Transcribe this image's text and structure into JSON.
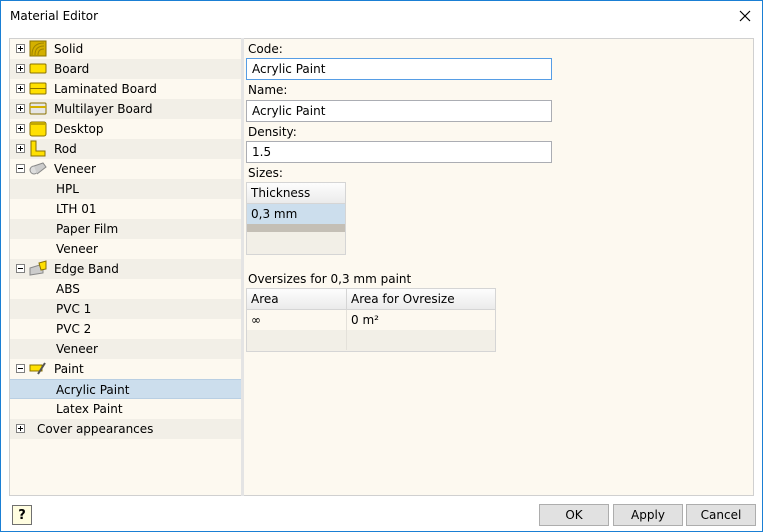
{
  "window": {
    "title": "Material Editor"
  },
  "tree": {
    "items": [
      {
        "label": "Solid",
        "level": 0,
        "expander": "plus",
        "icon": "solid-wood-icon"
      },
      {
        "label": "Board",
        "level": 0,
        "expander": "plus",
        "icon": "board-icon"
      },
      {
        "label": "Laminated Board",
        "level": 0,
        "expander": "plus",
        "icon": "laminated-board-icon"
      },
      {
        "label": "Multilayer Board",
        "level": 0,
        "expander": "plus",
        "icon": "multilayer-board-icon"
      },
      {
        "label": "Desktop",
        "level": 0,
        "expander": "plus",
        "icon": "desktop-icon"
      },
      {
        "label": "Rod",
        "level": 0,
        "expander": "plus",
        "icon": "rod-icon"
      },
      {
        "label": "Veneer",
        "level": 0,
        "expander": "minus",
        "icon": "veneer-icon"
      },
      {
        "label": "HPL",
        "level": 1
      },
      {
        "label": "LTH 01",
        "level": 1
      },
      {
        "label": "Paper Film",
        "level": 1
      },
      {
        "label": "Veneer",
        "level": 1
      },
      {
        "label": "Edge Band",
        "level": 0,
        "expander": "minus",
        "icon": "edge-band-icon"
      },
      {
        "label": "ABS",
        "level": 1
      },
      {
        "label": "PVC 1",
        "level": 1
      },
      {
        "label": "PVC 2",
        "level": 1
      },
      {
        "label": "Veneer",
        "level": 1
      },
      {
        "label": "Paint",
        "level": 0,
        "expander": "minus",
        "icon": "paint-icon"
      },
      {
        "label": "Acrylic Paint",
        "level": 1,
        "selected": true
      },
      {
        "label": "Latex Paint",
        "level": 1
      },
      {
        "label": "Cover appearances",
        "level": 0,
        "expander": "plus",
        "icon": null
      }
    ]
  },
  "form": {
    "code_label": "Code:",
    "code_value": "Acrylic Paint",
    "name_label": "Name:",
    "name_value": "Acrylic Paint",
    "density_label": "Density:",
    "density_value": "1.5",
    "sizes_label": "Sizes:",
    "sizes_table": {
      "headers": [
        "Thickness"
      ],
      "rows": [
        [
          "0,3 mm"
        ]
      ]
    },
    "oversizes_label": "Oversizes for 0,3 mm paint",
    "oversizes_table": {
      "headers": [
        "Area",
        "Area for Ovresize"
      ],
      "rows": [
        [
          "∞",
          "0 m²"
        ]
      ]
    }
  },
  "buttons": {
    "ok": "OK",
    "apply": "Apply",
    "cancel": "Cancel",
    "help": "?"
  },
  "colors": {
    "selection": "#ccdeed",
    "panel_bg": "#fdf9f0",
    "alt_row": "#f2efe7",
    "window_border": "#1a7fd4"
  }
}
